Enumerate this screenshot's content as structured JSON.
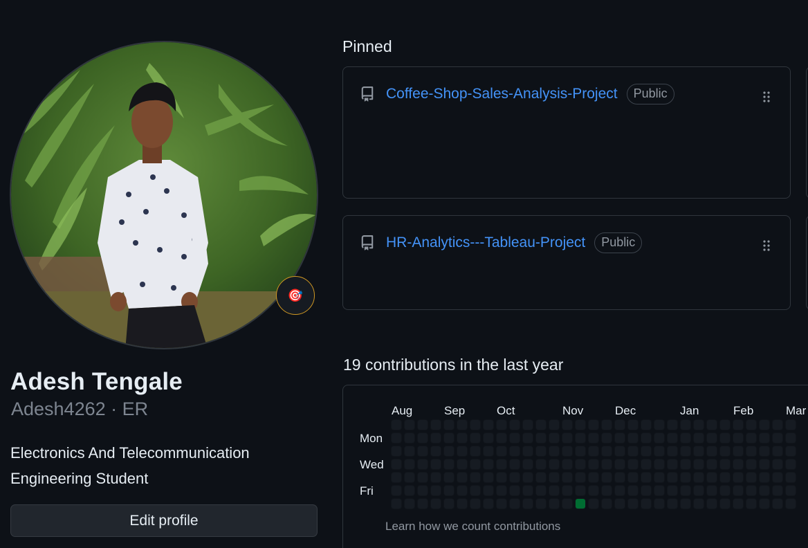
{
  "profile": {
    "name": "Adesh Tengale",
    "handle": "Adesh4262 · ER",
    "bio_line1": "Electronics And Telecommunication",
    "bio_line2": "Engineering Student",
    "edit_button": "Edit profile",
    "status_emoji": "🎯"
  },
  "pinned": {
    "title": "Pinned",
    "repos": [
      {
        "name": "Coffee-Shop-Sales-Analysis-Project",
        "visibility": "Public"
      },
      {
        "name": "HR-Analytics---Tableau-Project",
        "visibility": "Public"
      }
    ]
  },
  "contributions": {
    "title": "19 contributions in the last year",
    "months": [
      "Aug",
      "Sep",
      "Oct",
      "Nov",
      "Dec",
      "Jan",
      "Feb",
      "Mar"
    ],
    "days": [
      "Mon",
      "Wed",
      "Fri"
    ],
    "learn_link": "Learn how we count contributions",
    "colors": {
      "empty": "#161b22",
      "level1": "#0e4429",
      "level2": "#006d32",
      "level3": "#26a641"
    },
    "active_cells": [
      {
        "week": 14,
        "day": 6,
        "level": 2
      }
    ]
  },
  "icons": {
    "repo": "repo-icon",
    "drag": "grabber-icon",
    "status": "target-emoji-icon"
  }
}
